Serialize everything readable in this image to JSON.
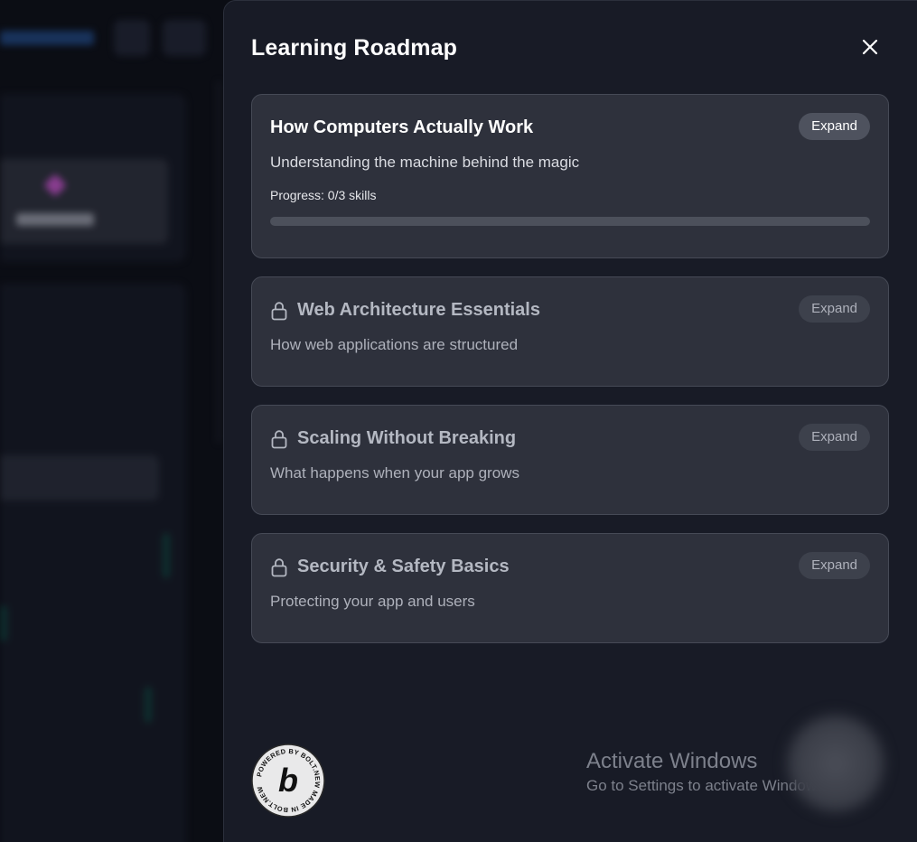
{
  "modal": {
    "title": "Learning Roadmap",
    "close_icon": "close-icon"
  },
  "modules": [
    {
      "title": "How Computers Actually Work",
      "description": "Understanding the machine behind the magic",
      "expand_label": "Expand",
      "locked": false,
      "progress_text": "Progress: 0/3 skills",
      "progress_fraction": 0
    },
    {
      "title": "Web Architecture Essentials",
      "description": "How web applications are structured",
      "expand_label": "Expand",
      "locked": true,
      "icon": "lock-icon"
    },
    {
      "title": "Scaling Without Breaking",
      "description": "What happens when your app grows",
      "expand_label": "Expand",
      "locked": true,
      "icon": "lock-icon"
    },
    {
      "title": "Security & Safety Basics",
      "description": "Protecting your app and users",
      "expand_label": "Expand",
      "locked": true,
      "icon": "lock-icon"
    }
  ],
  "badge": {
    "text": "POWERED BY BOLT.NEW MADE IN BOLT.NEW",
    "letter": "b"
  },
  "watermark": {
    "title": "Activate Windows",
    "subtitle": "Go to Settings to activate Windows."
  },
  "colors": {
    "modal_bg": "#181b26",
    "card_bg": "#2e313c",
    "accent": "#7c5cff"
  }
}
